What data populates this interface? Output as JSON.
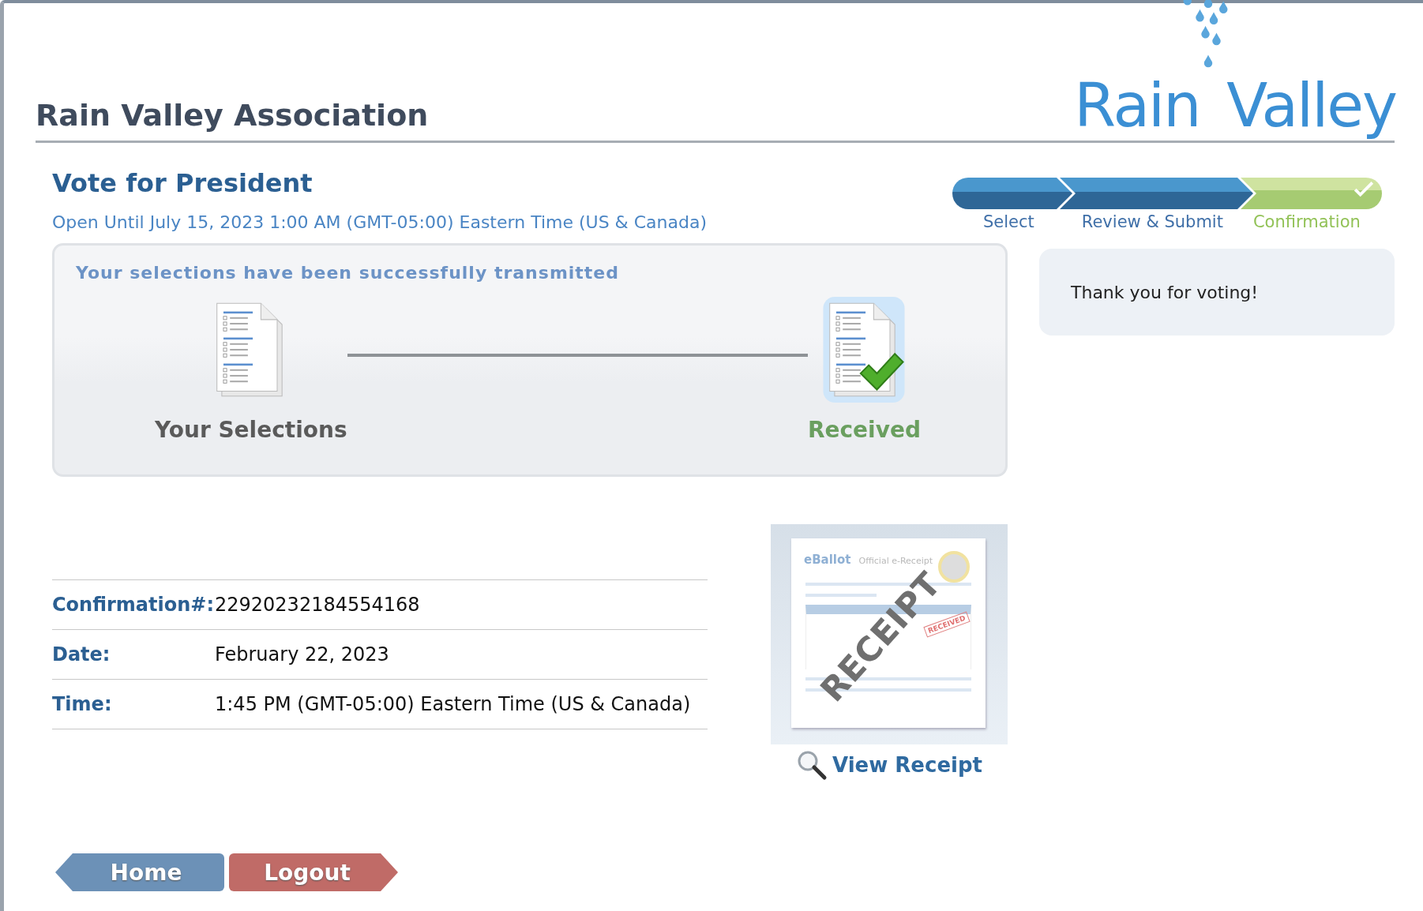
{
  "header": {
    "title": "Rain Valley Association",
    "logo": {
      "word1": "Rain",
      "word2": "Valley"
    }
  },
  "ballot": {
    "title": "Vote for President",
    "open_until": "Open Until July 15, 2023 1:00 AM (GMT-05:00) Eastern Time (US & Canada)"
  },
  "steps": [
    {
      "label": "Select",
      "selected": false
    },
    {
      "label": "Review & Submit",
      "selected": false
    },
    {
      "label": "Confirmation",
      "selected": true
    }
  ],
  "transmit_panel": {
    "message": "Your selections have been successfully transmitted",
    "from_label": "Your Selections",
    "to_label": "Received"
  },
  "thanks": "Thank you for voting!",
  "details": [
    {
      "label": "Confirmation#:",
      "value": "22920232184554168"
    },
    {
      "label": "Date:",
      "value": "February 22, 2023"
    },
    {
      "label": "Time:",
      "value": "1:45 PM (GMT-05:00) Eastern Time (US & Canada)"
    }
  ],
  "receipt": {
    "brand": "eBallot",
    "heading": "Official e-Receipt",
    "stamp": "RECEIPT",
    "seal": "RECEIVED",
    "link": "View Receipt"
  },
  "buttons": [
    {
      "label": "Home",
      "kind": "back"
    },
    {
      "label": "Logout",
      "kind": "forward"
    }
  ]
}
